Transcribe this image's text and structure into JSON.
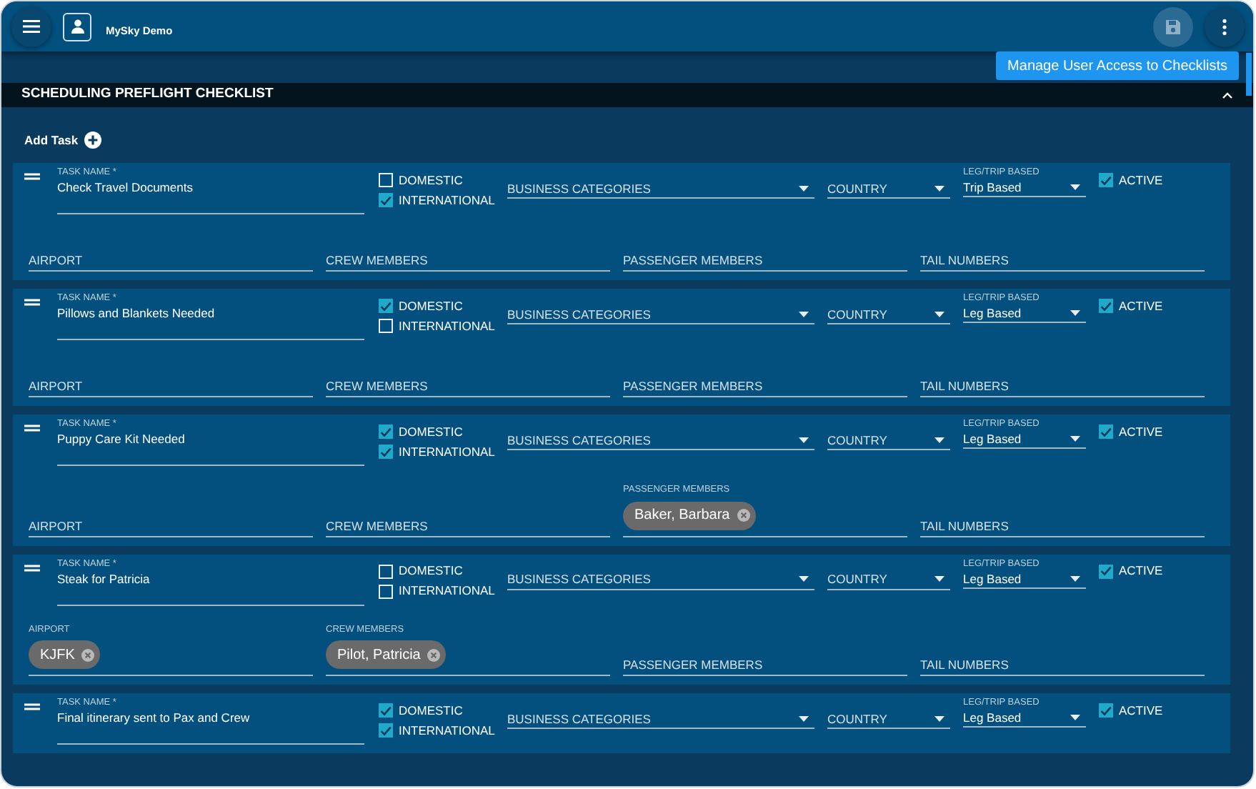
{
  "app": {
    "title": "MySky Demo"
  },
  "manage_button": "Manage User Access to Checklists",
  "section": {
    "title": "SCHEDULING PREFLIGHT CHECKLIST",
    "expanded": true
  },
  "add_task": "Add Task",
  "tasks": [
    {
      "name_label": "TASK NAME *",
      "name": "Check Travel Documents",
      "domestic": {
        "label": "DOMESTIC",
        "checked": false
      },
      "international": {
        "label": "INTERNATIONAL",
        "checked": true
      },
      "business_categories": "BUSINESS CATEGORIES",
      "country": "COUNTRY",
      "leg_trip": {
        "label": "LEG/TRIP BASED",
        "value": "Trip Based"
      },
      "active": {
        "label": "ACTIVE",
        "checked": true
      },
      "fields": [
        {
          "label": "AIRPORT"
        },
        {
          "label": "CREW MEMBERS"
        },
        {
          "label": "PASSENGER MEMBERS"
        },
        {
          "label": "TAIL NUMBERS"
        }
      ]
    },
    {
      "name_label": "TASK NAME *",
      "name": "Pillows and Blankets Needed",
      "domestic": {
        "label": "DOMESTIC",
        "checked": true
      },
      "international": {
        "label": "INTERNATIONAL",
        "checked": false
      },
      "business_categories": "BUSINESS CATEGORIES",
      "country": "COUNTRY",
      "leg_trip": {
        "label": "LEG/TRIP BASED",
        "value": "Leg Based"
      },
      "active": {
        "label": "ACTIVE",
        "checked": true
      },
      "fields": [
        {
          "label": "AIRPORT"
        },
        {
          "label": "CREW MEMBERS"
        },
        {
          "label": "PASSENGER MEMBERS"
        },
        {
          "label": "TAIL NUMBERS"
        }
      ]
    },
    {
      "name_label": "TASK NAME *",
      "name": "Puppy Care Kit Needed",
      "domestic": {
        "label": "DOMESTIC",
        "checked": true
      },
      "international": {
        "label": "INTERNATIONAL",
        "checked": true
      },
      "business_categories": "BUSINESS CATEGORIES",
      "country": "COUNTRY",
      "leg_trip": {
        "label": "LEG/TRIP BASED",
        "value": "Leg Based"
      },
      "active": {
        "label": "ACTIVE",
        "checked": true
      },
      "fields": [
        {
          "label": "AIRPORT"
        },
        {
          "label": "CREW MEMBERS"
        },
        {
          "label": "PASSENGER MEMBERS",
          "chips": [
            "Baker, Barbara"
          ]
        },
        {
          "label": "TAIL NUMBERS"
        }
      ]
    },
    {
      "name_label": "TASK NAME *",
      "name": "Steak for Patricia",
      "domestic": {
        "label": "DOMESTIC",
        "checked": false
      },
      "international": {
        "label": "INTERNATIONAL",
        "checked": false
      },
      "business_categories": "BUSINESS CATEGORIES",
      "country": "COUNTRY",
      "leg_trip": {
        "label": "LEG/TRIP BASED",
        "value": "Leg Based"
      },
      "active": {
        "label": "ACTIVE",
        "checked": true
      },
      "fields": [
        {
          "label": "AIRPORT",
          "chips": [
            "KJFK"
          ]
        },
        {
          "label": "CREW MEMBERS",
          "chips": [
            "Pilot, Patricia"
          ]
        },
        {
          "label": "PASSENGER MEMBERS"
        },
        {
          "label": "TAIL NUMBERS"
        }
      ]
    },
    {
      "name_label": "TASK NAME *",
      "name": "Final itinerary sent to Pax and Crew",
      "domestic": {
        "label": "DOMESTIC",
        "checked": true
      },
      "international": {
        "label": "INTERNATIONAL",
        "checked": true
      },
      "business_categories": "BUSINESS CATEGORIES",
      "country": "COUNTRY",
      "leg_trip": {
        "label": "LEG/TRIP BASED",
        "value": "Leg Based"
      },
      "active": {
        "label": "ACTIVE",
        "checked": true
      }
    }
  ]
}
